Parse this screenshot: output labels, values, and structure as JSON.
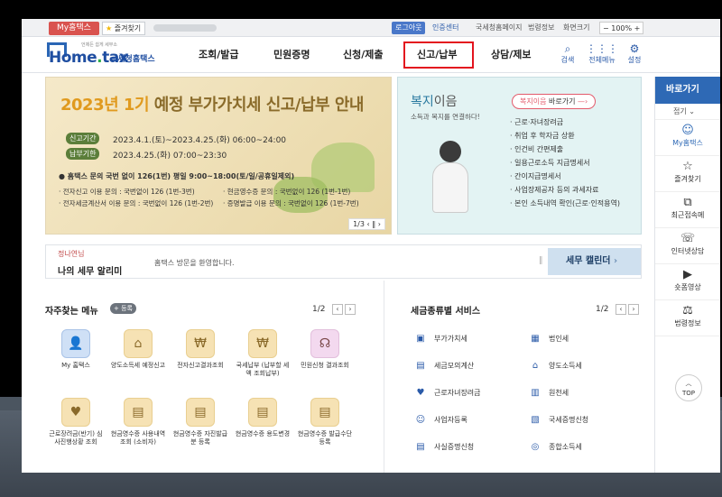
{
  "util": {
    "myhome": "My홈택스",
    "favorite": "즐겨찾기",
    "logout": "로그아웃",
    "cert": "인증센터",
    "links": [
      "국세청홈페이지",
      "법령정보",
      "화면크기"
    ],
    "zoom": "100%"
  },
  "logo": {
    "brand_a": "Home",
    "brand_b": "tax",
    "sub": "국세청홈택스",
    "tiny": "언제든 쉽게 세무소"
  },
  "nav": {
    "items": [
      "조회/발급",
      "민원증명",
      "신청/제출",
      "신고/납부",
      "상담/제보"
    ],
    "search": "검색",
    "allmenu": "전체메뉴",
    "settings": "설정"
  },
  "banner": {
    "title_a": "2023년 1기",
    "title_b": "예정 부가가치세 신고/납부 안내",
    "pill1": "신고기간",
    "date1": "2023.4.1.(토)~2023.4.25.(화) 06:00~24:00",
    "pill2": "납부기한",
    "date2": "2023.4.25.(화) 07:00~23:30",
    "info_main": "● 홈택스 문의 국번 없이 126(1번) 평일 9:00~18:00(토/일/공휴일제외)",
    "info_l1": "· 전자신고 이용 문의 : 국번없이 126 (1번-3번)",
    "info_l2": "· 전자세금계산서 이용 문의 : 국번없이 126 (1번-2번)",
    "info_r1": "· 현금영수증 문의 : 국번없이 126 (1번-1번)",
    "info_r2": "· 증명발급 이용 문의 : 국번없이 126 (1번-7번)",
    "pager": "1/3"
  },
  "welfare": {
    "title_a": "복지",
    "title_b": "이음",
    "sub": "소득과 복지를 연결하다!",
    "button_a": "복지이음",
    "button_b": "바로가기",
    "list": [
      "근로·자녀장려금",
      "취업 후 학자금 상환",
      "인건비 간편제출",
      "일용근로소득 지급명세서",
      "간이지급명세서",
      "사업장제공자 등의 과세자료",
      "본인 소득내역 확인(근로·인적용역)"
    ]
  },
  "notice": {
    "small": "정나연님",
    "title": "나의 세무 알리미",
    "message": "홈택스 방문을 환영합니다.",
    "calendar": "세무 캘린더"
  },
  "quick": {
    "title": "자주찾는 메뉴",
    "add": "+ 등록",
    "pager": "1/2",
    "items": [
      {
        "label": "My 홈택스",
        "icon": "user-icon",
        "glyph": "👤"
      },
      {
        "label": "양도소득세 예정신고",
        "icon": "house-icon",
        "glyph": "⌂"
      },
      {
        "label": "전자신고결과조회",
        "icon": "document-icon",
        "glyph": "₩"
      },
      {
        "label": "국세납부 (납부할 세액 조회납부)",
        "icon": "moneybag-icon",
        "glyph": "₩"
      },
      {
        "label": "민원신청 결과조회",
        "icon": "headset-icon",
        "glyph": "☊"
      },
      {
        "label": "근로장려금(반기) 심사진행상황 조회",
        "icon": "heart-hand-icon",
        "glyph": "♥"
      },
      {
        "label": "현금영수증 사용내역조회 (소비자)",
        "icon": "receipt-icon",
        "glyph": "▤"
      },
      {
        "label": "현금영수증 자진발급분 등록",
        "icon": "receipt-icon",
        "glyph": "▤"
      },
      {
        "label": "현금영수증 용도변경",
        "icon": "receipt-icon",
        "glyph": "▤"
      },
      {
        "label": "현금영수증 발급수단 등록",
        "icon": "receipt-icon",
        "glyph": "▤"
      }
    ]
  },
  "tax": {
    "title": "세금종류별 서비스",
    "pager": "1/2",
    "items": [
      {
        "label": "부가가치세",
        "icon": "vat-icon",
        "glyph": "▣"
      },
      {
        "label": "법인세",
        "icon": "building-icon",
        "glyph": "▦"
      },
      {
        "label": "세금모의계산",
        "icon": "calculator-icon",
        "glyph": "▤"
      },
      {
        "label": "양도소득세",
        "icon": "house-icon",
        "glyph": "⌂"
      },
      {
        "label": "근로자녀장려금",
        "icon": "heart-icon",
        "glyph": "♥"
      },
      {
        "label": "원천세",
        "icon": "document-icon",
        "glyph": "▥"
      },
      {
        "label": "사업자등록",
        "icon": "user-icon",
        "glyph": "☺"
      },
      {
        "label": "국세증명신청",
        "icon": "certificate-icon",
        "glyph": "▧"
      },
      {
        "label": "사실증명신청",
        "icon": "file-icon",
        "glyph": "▤"
      },
      {
        "label": "종합소득세",
        "icon": "coins-icon",
        "glyph": "◎"
      }
    ]
  },
  "side": {
    "header": "바로가기",
    "fold": "접기",
    "items": [
      {
        "label": "My홈택스",
        "icon": "user-icon",
        "glyph": "☺"
      },
      {
        "label": "즐겨찾기",
        "icon": "star-icon",
        "glyph": "☆"
      },
      {
        "label": "최근접속메",
        "icon": "recent-icon",
        "glyph": "⧉"
      },
      {
        "label": "인터넷상담",
        "icon": "chat-icon",
        "glyph": "☏"
      },
      {
        "label": "숏폼영상",
        "icon": "play-icon",
        "glyph": "▶"
      },
      {
        "label": "법령정보",
        "icon": "gavel-icon",
        "glyph": "⚖"
      }
    ],
    "top": "TOP"
  }
}
